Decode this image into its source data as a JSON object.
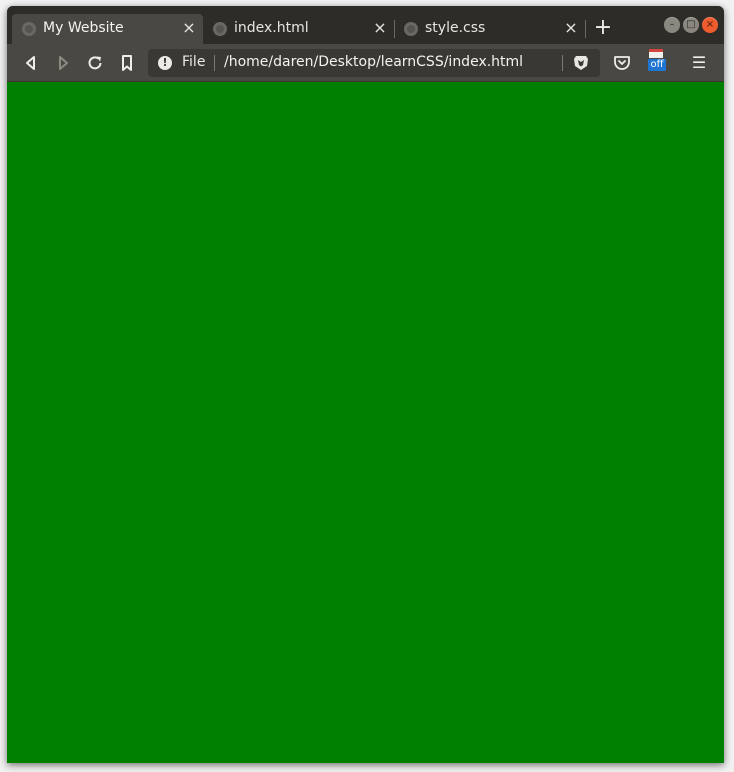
{
  "tabs": [
    {
      "label": "My Website",
      "close": "×",
      "active": true
    },
    {
      "label": "index.html",
      "close": "×",
      "active": false
    },
    {
      "label": "style.css",
      "close": "×",
      "active": false
    }
  ],
  "new_tab_glyph": "+",
  "window_controls": {
    "minimize": "–",
    "maximize": "□",
    "close": "×"
  },
  "toolbar": {
    "back_icon": "back-icon",
    "forward_icon": "forward-icon",
    "reload_icon": "reload-icon",
    "bookmark_icon": "bookmark-icon",
    "menu_icon": "hamburger-menu-icon",
    "menu_glyph": "☰"
  },
  "url": {
    "info_glyph": "!",
    "scheme_label": "File",
    "path": "/home/daren/Desktop/learnCSS/index.html"
  },
  "extension": {
    "badge": "off"
  },
  "page": {
    "background_color": "#008000"
  },
  "colors": {
    "tabstrip": "#2e2c29",
    "toolbar": "#4a4843",
    "urlbar": "#3a3835",
    "close_button": "#ee5b2d",
    "extension_badge": "#1f76d2",
    "brave_shield": "#e8e6e1"
  }
}
